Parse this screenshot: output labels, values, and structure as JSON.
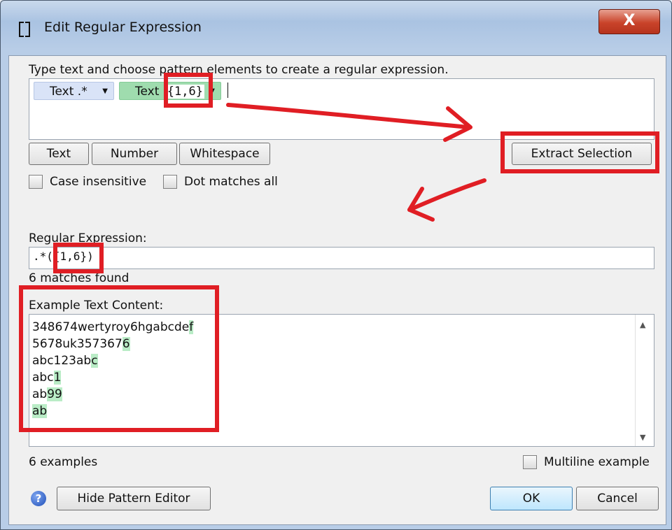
{
  "window": {
    "title": "Edit Regular Expression",
    "close_label": "X"
  },
  "editor": {
    "instructions": "Type text and choose pattern elements to create a regular expression.",
    "tokens": [
      {
        "label": "Text .*",
        "color": "#d9e3f7"
      },
      {
        "label": "Text",
        "quantifier": "{1,6}",
        "color": "#9fdcae"
      }
    ],
    "buttons": {
      "text": "Text",
      "number": "Number",
      "whitespace": "Whitespace",
      "extract": "Extract Selection"
    },
    "options": {
      "case_insensitive": "Case insensitive",
      "dot_matches_all": "Dot matches all"
    }
  },
  "regex": {
    "label": "Regular Expression:",
    "value": ".*( {1,6})",
    "prefix": ".*(",
    "quantifier": "{1,6}",
    "suffix": ")",
    "matches": "6 matches found"
  },
  "examples": {
    "label": "Example Text Content:",
    "lines": [
      {
        "plain": "348674wertyroy6hgabcde",
        "match": "f"
      },
      {
        "plain": "5678uk357367",
        "match": "6"
      },
      {
        "plain": "abc123ab",
        "match": "c"
      },
      {
        "plain": "abc",
        "match": "1"
      },
      {
        "plain": "ab",
        "match": "99"
      },
      {
        "plain": "",
        "match": "ab"
      }
    ],
    "count": "6 examples",
    "multiline_label": "Multiline example"
  },
  "footer": {
    "hide_editor": "Hide Pattern Editor",
    "ok": "OK",
    "cancel": "Cancel"
  },
  "colors": {
    "annotation_red": "#e01e24",
    "match_highlight": "#b9ecc6"
  }
}
